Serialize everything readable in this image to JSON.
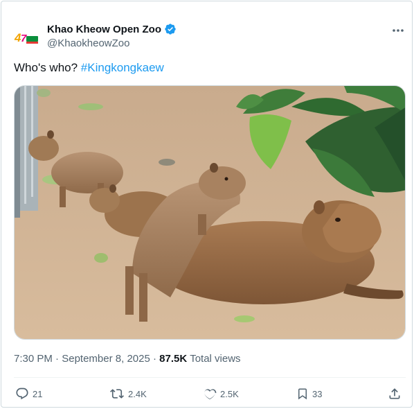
{
  "author": {
    "name": "Khao Kheow Open Zoo",
    "handle": "@KhaokheowZoo",
    "verified": true,
    "avatar_icon": "zoo-logo"
  },
  "tweet": {
    "text_prefix": "Who's who? ",
    "hashtag": "#Kingkongkaew"
  },
  "meta": {
    "time": "7:30 PM",
    "separator": " · ",
    "date": "September 8, 2025",
    "dot": " · ",
    "views_count": "87.5K",
    "views_label": "Total views"
  },
  "actions": {
    "replies": "21",
    "reposts": "2.4K",
    "likes": "2.5K",
    "bookmarks": "33"
  },
  "colors": {
    "accent": "#1d9bf0",
    "text_primary": "#0f1419",
    "text_secondary": "#536471"
  }
}
